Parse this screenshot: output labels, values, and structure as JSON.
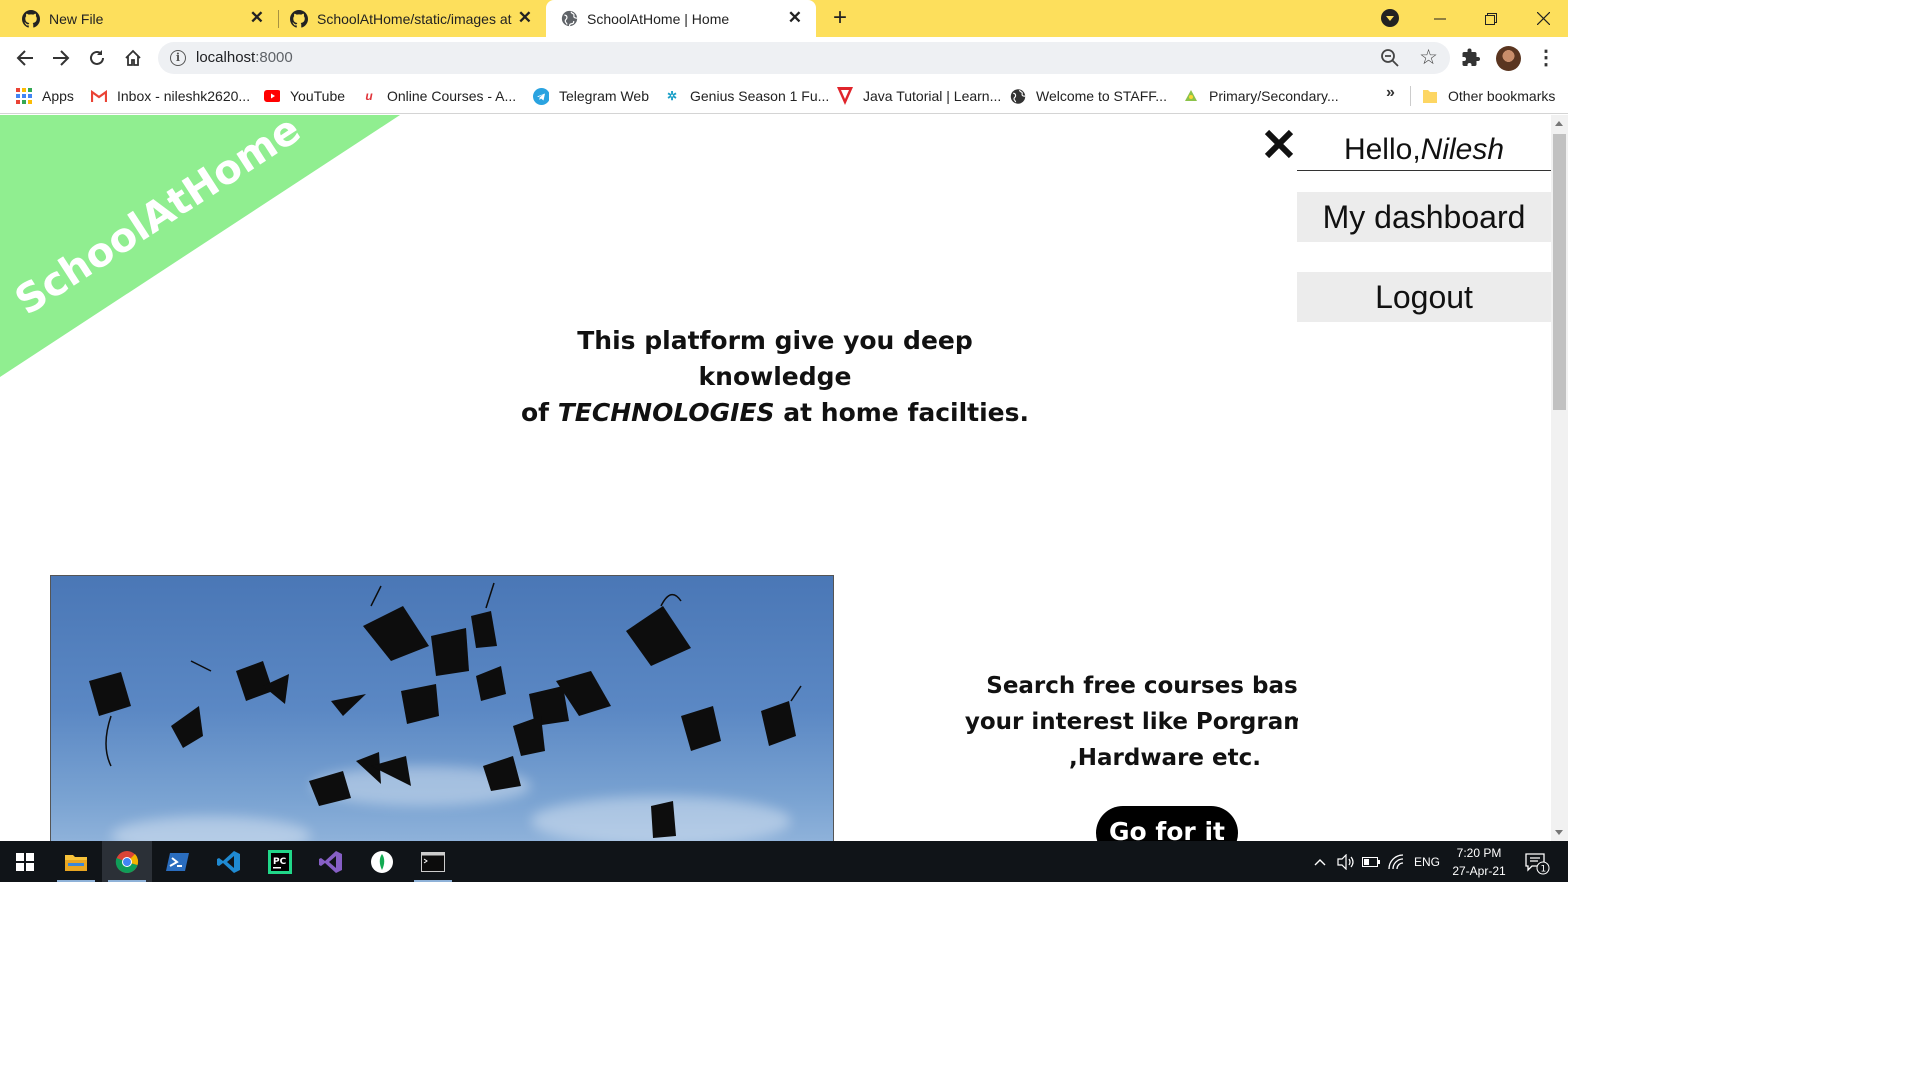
{
  "browser": {
    "tabs": [
      {
        "title": "New File",
        "icon": "github-icon",
        "active": false
      },
      {
        "title": "SchoolAtHome/static/images at m",
        "icon": "github-icon",
        "active": false
      },
      {
        "title": "SchoolAtHome | Home",
        "icon": "globe-icon",
        "active": true
      }
    ],
    "url_host": "localhost",
    "url_port": ":8000",
    "accent_color": "#fddf5c",
    "bookmarks": [
      {
        "label": "Apps",
        "icon": "apps-grid-icon"
      },
      {
        "label": "Inbox - nileshk2620...",
        "icon": "gmail-icon"
      },
      {
        "label": "YouTube",
        "icon": "youtube-icon"
      },
      {
        "label": "Online Courses - A...",
        "icon": "udemy-icon"
      },
      {
        "label": "Telegram Web",
        "icon": "telegram-icon"
      },
      {
        "label": "Genius Season 1 Fu...",
        "icon": "genius-icon"
      },
      {
        "label": "Java Tutorial | Learn...",
        "icon": "javatpoint-icon"
      },
      {
        "label": "Welcome to STAFF...",
        "icon": "globe-icon"
      },
      {
        "label": "Primary/Secondary...",
        "icon": "bookmark-icon"
      }
    ],
    "more_bookmarks": "»",
    "other_bookmarks": "Other bookmarks"
  },
  "page": {
    "brand": "SchoolAtHome",
    "brand_color": "#90ee90",
    "greeting_prefix": "Hello,",
    "user_name": "Nilesh",
    "menu": {
      "dashboard": "My dashboard",
      "logout": "Logout"
    },
    "tagline_line1": "This platform give you deep knowledge",
    "tagline_of": "of",
    "tagline_em": "TECHNOLOGIES",
    "tagline_rest": "at home facilties.",
    "promo_line1": "Search free courses based",
    "promo_line2": "your interest like Porgrami",
    "promo_line3": ",Hardware etc.",
    "cta_label": "Go for it"
  },
  "taskbar": {
    "apps": [
      "start",
      "file-explorer",
      "chrome",
      "powershell",
      "vscode",
      "pycharm",
      "visual-studio",
      "mongodb-compass",
      "terminal"
    ],
    "language": "ENG",
    "time": "7:20 PM",
    "date": "27-Apr-21",
    "notification_count": "1"
  }
}
